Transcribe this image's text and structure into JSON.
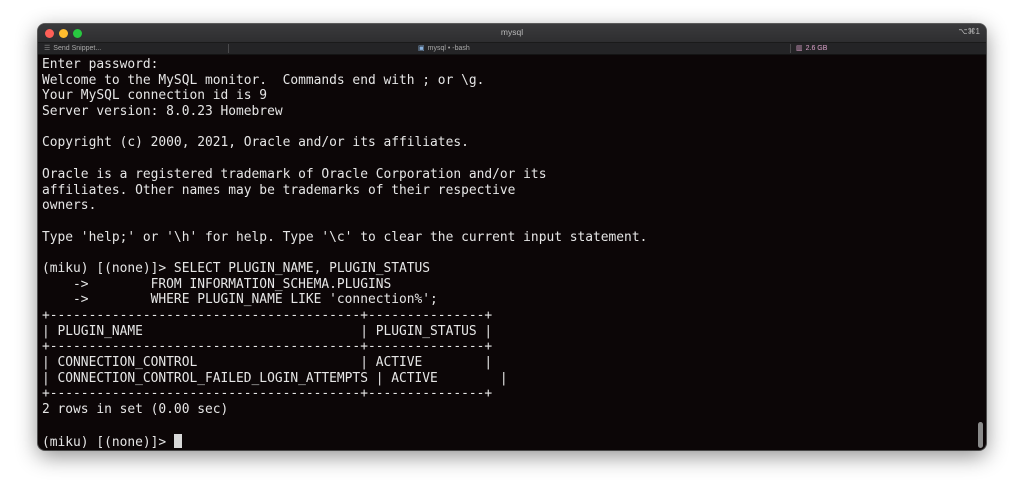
{
  "window": {
    "title": "mysql",
    "shortcut": "⌥⌘1"
  },
  "tabbar": {
    "snippet_label": "Send Snippet...",
    "tab_label": "mysql • -bash",
    "memory_label": "2.6 GB"
  },
  "icons": {
    "snippet": "list-icon",
    "tab": "folder-icon",
    "memory": "memory-icon"
  },
  "colors": {
    "background": "#0c0607",
    "text": "#e6e6e6",
    "memory": "#d9a0c8"
  },
  "terminal": {
    "lines": [
      "Enter password:",
      "Welcome to the MySQL monitor.  Commands end with ; or \\g.",
      "Your MySQL connection id is 9",
      "Server version: 8.0.23 Homebrew",
      "",
      "Copyright (c) 2000, 2021, Oracle and/or its affiliates.",
      "",
      "Oracle is a registered trademark of Oracle Corporation and/or its",
      "affiliates. Other names may be trademarks of their respective",
      "owners.",
      "",
      "Type 'help;' or '\\h' for help. Type '\\c' to clear the current input statement.",
      "",
      "(miku) [(none)]> SELECT PLUGIN_NAME, PLUGIN_STATUS",
      "    ->        FROM INFORMATION_SCHEMA.PLUGINS",
      "    ->        WHERE PLUGIN_NAME LIKE 'connection%';",
      "+----------------------------------------+---------------+",
      "| PLUGIN_NAME                            | PLUGIN_STATUS |",
      "+----------------------------------------+---------------+",
      "| CONNECTION_CONTROL                     | ACTIVE        |",
      "| CONNECTION_CONTROL_FAILED_LOGIN_ATTEMPTS | ACTIVE        |",
      "+----------------------------------------+---------------+",
      "2 rows in set (0.00 sec)",
      ""
    ],
    "prompt": "(miku) [(none)]> "
  }
}
